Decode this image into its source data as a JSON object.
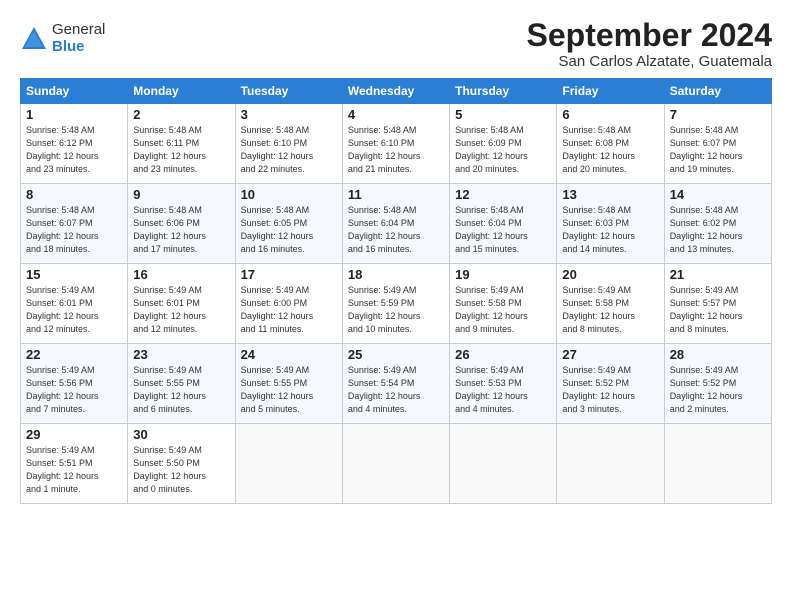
{
  "header": {
    "logo_general": "General",
    "logo_blue": "Blue",
    "title": "September 2024",
    "location": "San Carlos Alzatate, Guatemala"
  },
  "days_of_week": [
    "Sunday",
    "Monday",
    "Tuesday",
    "Wednesday",
    "Thursday",
    "Friday",
    "Saturday"
  ],
  "weeks": [
    [
      {
        "day": "1",
        "info": "Sunrise: 5:48 AM\nSunset: 6:12 PM\nDaylight: 12 hours\nand 23 minutes."
      },
      {
        "day": "2",
        "info": "Sunrise: 5:48 AM\nSunset: 6:11 PM\nDaylight: 12 hours\nand 23 minutes."
      },
      {
        "day": "3",
        "info": "Sunrise: 5:48 AM\nSunset: 6:10 PM\nDaylight: 12 hours\nand 22 minutes."
      },
      {
        "day": "4",
        "info": "Sunrise: 5:48 AM\nSunset: 6:10 PM\nDaylight: 12 hours\nand 21 minutes."
      },
      {
        "day": "5",
        "info": "Sunrise: 5:48 AM\nSunset: 6:09 PM\nDaylight: 12 hours\nand 20 minutes."
      },
      {
        "day": "6",
        "info": "Sunrise: 5:48 AM\nSunset: 6:08 PM\nDaylight: 12 hours\nand 20 minutes."
      },
      {
        "day": "7",
        "info": "Sunrise: 5:48 AM\nSunset: 6:07 PM\nDaylight: 12 hours\nand 19 minutes."
      }
    ],
    [
      {
        "day": "8",
        "info": "Sunrise: 5:48 AM\nSunset: 6:07 PM\nDaylight: 12 hours\nand 18 minutes."
      },
      {
        "day": "9",
        "info": "Sunrise: 5:48 AM\nSunset: 6:06 PM\nDaylight: 12 hours\nand 17 minutes."
      },
      {
        "day": "10",
        "info": "Sunrise: 5:48 AM\nSunset: 6:05 PM\nDaylight: 12 hours\nand 16 minutes."
      },
      {
        "day": "11",
        "info": "Sunrise: 5:48 AM\nSunset: 6:04 PM\nDaylight: 12 hours\nand 16 minutes."
      },
      {
        "day": "12",
        "info": "Sunrise: 5:48 AM\nSunset: 6:04 PM\nDaylight: 12 hours\nand 15 minutes."
      },
      {
        "day": "13",
        "info": "Sunrise: 5:48 AM\nSunset: 6:03 PM\nDaylight: 12 hours\nand 14 minutes."
      },
      {
        "day": "14",
        "info": "Sunrise: 5:48 AM\nSunset: 6:02 PM\nDaylight: 12 hours\nand 13 minutes."
      }
    ],
    [
      {
        "day": "15",
        "info": "Sunrise: 5:49 AM\nSunset: 6:01 PM\nDaylight: 12 hours\nand 12 minutes."
      },
      {
        "day": "16",
        "info": "Sunrise: 5:49 AM\nSunset: 6:01 PM\nDaylight: 12 hours\nand 12 minutes."
      },
      {
        "day": "17",
        "info": "Sunrise: 5:49 AM\nSunset: 6:00 PM\nDaylight: 12 hours\nand 11 minutes."
      },
      {
        "day": "18",
        "info": "Sunrise: 5:49 AM\nSunset: 5:59 PM\nDaylight: 12 hours\nand 10 minutes."
      },
      {
        "day": "19",
        "info": "Sunrise: 5:49 AM\nSunset: 5:58 PM\nDaylight: 12 hours\nand 9 minutes."
      },
      {
        "day": "20",
        "info": "Sunrise: 5:49 AM\nSunset: 5:58 PM\nDaylight: 12 hours\nand 8 minutes."
      },
      {
        "day": "21",
        "info": "Sunrise: 5:49 AM\nSunset: 5:57 PM\nDaylight: 12 hours\nand 8 minutes."
      }
    ],
    [
      {
        "day": "22",
        "info": "Sunrise: 5:49 AM\nSunset: 5:56 PM\nDaylight: 12 hours\nand 7 minutes."
      },
      {
        "day": "23",
        "info": "Sunrise: 5:49 AM\nSunset: 5:55 PM\nDaylight: 12 hours\nand 6 minutes."
      },
      {
        "day": "24",
        "info": "Sunrise: 5:49 AM\nSunset: 5:55 PM\nDaylight: 12 hours\nand 5 minutes."
      },
      {
        "day": "25",
        "info": "Sunrise: 5:49 AM\nSunset: 5:54 PM\nDaylight: 12 hours\nand 4 minutes."
      },
      {
        "day": "26",
        "info": "Sunrise: 5:49 AM\nSunset: 5:53 PM\nDaylight: 12 hours\nand 4 minutes."
      },
      {
        "day": "27",
        "info": "Sunrise: 5:49 AM\nSunset: 5:52 PM\nDaylight: 12 hours\nand 3 minutes."
      },
      {
        "day": "28",
        "info": "Sunrise: 5:49 AM\nSunset: 5:52 PM\nDaylight: 12 hours\nand 2 minutes."
      }
    ],
    [
      {
        "day": "29",
        "info": "Sunrise: 5:49 AM\nSunset: 5:51 PM\nDaylight: 12 hours\nand 1 minute."
      },
      {
        "day": "30",
        "info": "Sunrise: 5:49 AM\nSunset: 5:50 PM\nDaylight: 12 hours\nand 0 minutes."
      },
      {
        "day": "",
        "info": ""
      },
      {
        "day": "",
        "info": ""
      },
      {
        "day": "",
        "info": ""
      },
      {
        "day": "",
        "info": ""
      },
      {
        "day": "",
        "info": ""
      }
    ]
  ]
}
